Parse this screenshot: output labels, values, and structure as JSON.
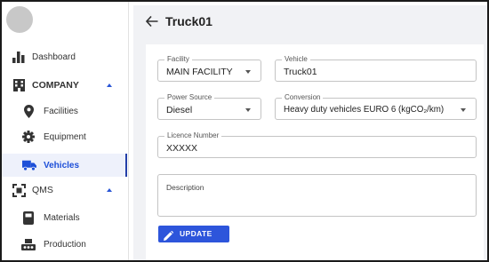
{
  "sidebar": {
    "items": [
      {
        "label": "Dashboard",
        "icon": "bar-chart-icon"
      },
      {
        "label": "COMPANY",
        "icon": "building-icon",
        "group": true
      },
      {
        "label": "Facilities",
        "icon": "location-pin-icon"
      },
      {
        "label": "Equipment",
        "icon": "gear-icon"
      },
      {
        "label": "Vehicles",
        "icon": "truck-icon",
        "active": true
      },
      {
        "label": "QMS",
        "icon": "qms-icon",
        "group": true
      },
      {
        "label": "Materials",
        "icon": "materials-icon"
      },
      {
        "label": "Production",
        "icon": "production-icon"
      }
    ]
  },
  "header": {
    "title": "Truck01"
  },
  "form": {
    "facility": {
      "label": "Facility",
      "value": "MAIN FACILITY"
    },
    "vehicle": {
      "label": "Vehicle",
      "value": "Truck01"
    },
    "power_source": {
      "label": "Power Source",
      "value": "Diesel"
    },
    "conversion": {
      "label": "Conversion",
      "value": "Heavy duty vehicles EURO 6 (kgCO₂/km)"
    },
    "licence_number": {
      "label": "Licence Number",
      "value": "XXXXX"
    },
    "description": {
      "label": "Description",
      "value": ""
    },
    "update_label": "UPDATE"
  },
  "colors": {
    "accent": "#2d55db",
    "active_text": "#1d4fd8",
    "main_background": "#f1f2f5"
  }
}
